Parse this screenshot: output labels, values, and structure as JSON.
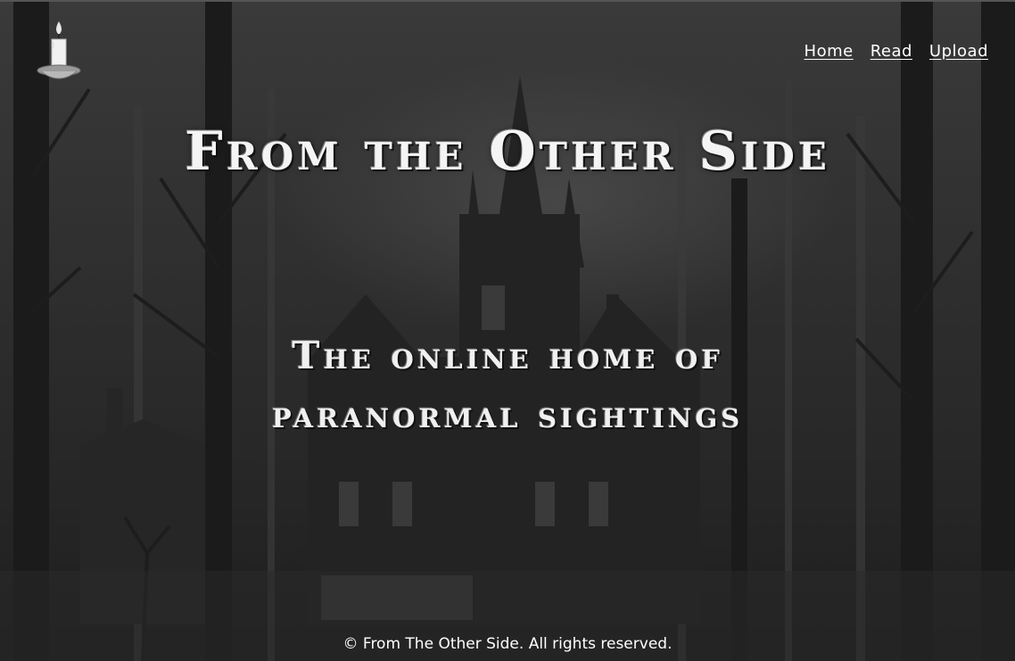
{
  "site": {
    "logo_icon": "candle-icon"
  },
  "nav": {
    "items": [
      {
        "label": "Home"
      },
      {
        "label": "Read"
      },
      {
        "label": "Upload"
      }
    ]
  },
  "hero": {
    "title": "From the Other Side",
    "tagline": "The online home of paranormal sightings"
  },
  "footer": {
    "text": "© From The Other Side. All rights reserved."
  },
  "colors": {
    "text": "#ffffff",
    "background": "#2a2a2a"
  }
}
